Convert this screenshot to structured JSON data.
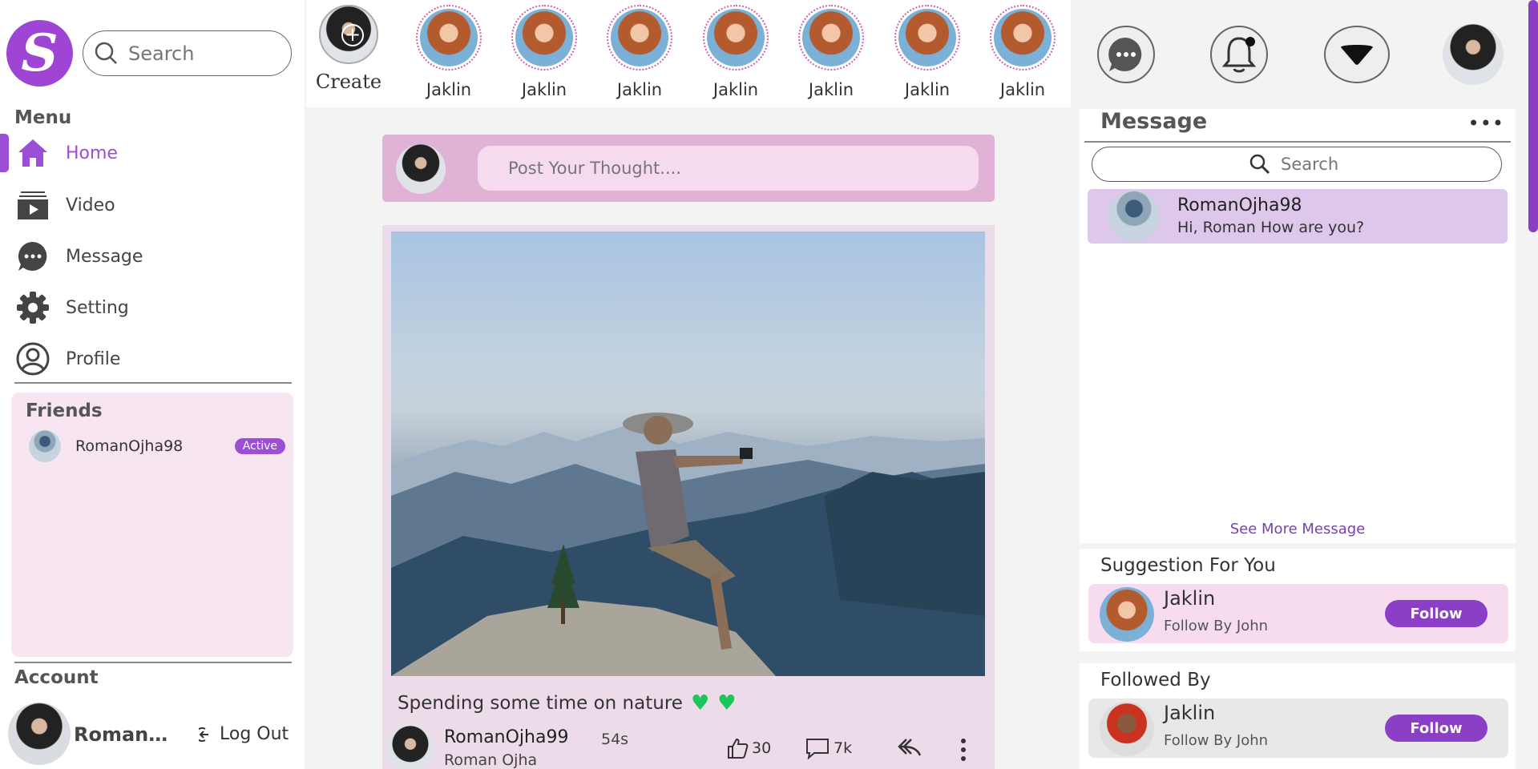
{
  "brand": {
    "logo_letter": "S",
    "accent": "#9b4fd4"
  },
  "search": {
    "placeholder": "Search"
  },
  "menu": {
    "title": "Menu",
    "items": [
      {
        "label": "Home",
        "icon": "home-icon"
      },
      {
        "label": "Video",
        "icon": "video-icon"
      },
      {
        "label": "Message",
        "icon": "message-icon"
      },
      {
        "label": "Setting",
        "icon": "gear-icon"
      },
      {
        "label": "Profile",
        "icon": "profile-icon"
      }
    ]
  },
  "friends": {
    "title": "Friends",
    "items": [
      {
        "name": "RomanOjha98",
        "status": "Active"
      }
    ]
  },
  "account": {
    "title": "Account",
    "name": "RomanOj...",
    "logout": "Log Out"
  },
  "stories": {
    "create_label": "Create",
    "items": [
      "Jaklin",
      "Jaklin",
      "Jaklin",
      "Jaklin",
      "Jaklin",
      "Jaklin",
      "Jaklin"
    ]
  },
  "composer": {
    "placeholder": "Post Your Thought...."
  },
  "post": {
    "caption": "Spending some time on nature",
    "username": "RomanOjha99",
    "fullname": "Roman Ojha",
    "time": "54s",
    "likes": "30",
    "comments": "7k"
  },
  "messages": {
    "title": "Message",
    "more": "•••",
    "search_placeholder": "Search",
    "items": [
      {
        "name": "RomanOjha98",
        "text": "Hi, Roman How are you?"
      }
    ],
    "see_more": "See More Message"
  },
  "suggestions": {
    "title": "Suggestion For You",
    "items": [
      {
        "name": "Jaklin",
        "sub": "Follow By John",
        "button": "Follow"
      }
    ]
  },
  "followed_by": {
    "title": "Followed By",
    "items": [
      {
        "name": "Jaklin",
        "sub": "Follow By John",
        "button": "Follow"
      }
    ]
  }
}
